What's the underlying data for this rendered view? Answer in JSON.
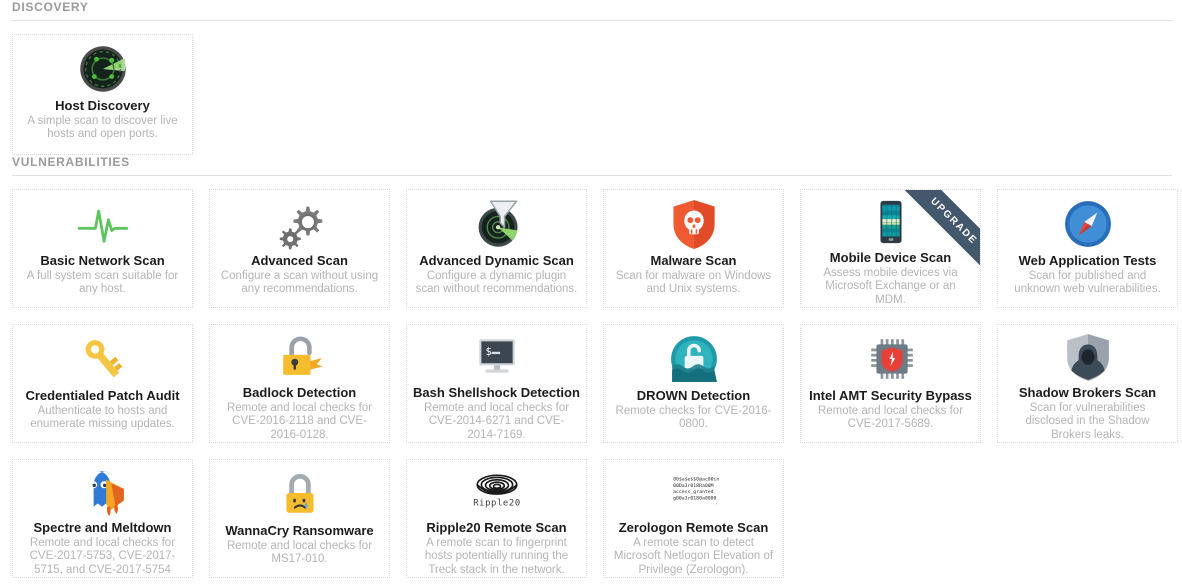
{
  "sections": [
    {
      "id": "discovery",
      "title": "DISCOVERY",
      "cards": [
        {
          "icon": "radar-sweep-icon",
          "title": "Host Discovery",
          "desc": "A simple scan to discover live hosts and open ports.",
          "badge": null
        }
      ]
    },
    {
      "id": "vulnerabilities",
      "title": "VULNERABILITIES",
      "cards": [
        {
          "icon": "heartbeat-pulse-icon",
          "title": "Basic Network Scan",
          "desc": "A full system scan suitable for any host.",
          "badge": null
        },
        {
          "icon": "gears-icon",
          "title": "Advanced Scan",
          "desc": "Configure a scan without using any recommendations.",
          "badge": null
        },
        {
          "icon": "radar-funnel-icon",
          "title": "Advanced Dynamic Scan",
          "desc": "Configure a dynamic plugin scan without recommendations.",
          "badge": null
        },
        {
          "icon": "skull-shield-icon",
          "title": "Malware Scan",
          "desc": "Scan for malware on Windows and Unix systems.",
          "badge": null
        },
        {
          "icon": "mobile-phone-icon",
          "title": "Mobile Device Scan",
          "desc": "Assess mobile devices via Microsoft Exchange or an MDM.",
          "badge": "UPGRADE"
        },
        {
          "icon": "compass-globe-icon",
          "title": "Web Application Tests",
          "desc": "Scan for published and unknown web vulnerabilities.",
          "badge": null
        },
        {
          "icon": "key-icon",
          "title": "Credentialed Patch Audit",
          "desc": "Authenticate to hosts and enumerate missing updates.",
          "badge": null
        },
        {
          "icon": "broken-padlock-icon",
          "title": "Badlock Detection",
          "desc": "Remote and local checks for CVE-2016-2118 and CVE-2016-0128.",
          "badge": null
        },
        {
          "icon": "terminal-monitor-icon",
          "title": "Bash Shellshock Detection",
          "desc": "Remote and local checks for CVE-2014-6271 and CVE-2014-7169.",
          "badge": null
        },
        {
          "icon": "drowning-lock-icon",
          "title": "DROWN Detection",
          "desc": "Remote checks for CVE-2016-0800.",
          "badge": null
        },
        {
          "icon": "cpu-chip-shield-icon",
          "title": "Intel AMT Security Bypass",
          "desc": "Remote and local checks for CVE-2017-5689.",
          "badge": null
        },
        {
          "icon": "hooded-figure-shield-icon",
          "title": "Shadow Brokers Scan",
          "desc": "Scan for vulnerabilities disclosed in the Shadow Brokers leaks.",
          "badge": null
        },
        {
          "icon": "ghost-meltdown-icon",
          "title": "Spectre and Meltdown",
          "desc": "Remote and local checks for CVE-2017-5753, CVE-2017-5715, and CVE-2017-5754",
          "badge": null
        },
        {
          "icon": "crying-padlock-icon",
          "title": "WannaCry Ransomware",
          "desc": "Remote and local checks for MS17-010.",
          "badge": null
        },
        {
          "icon": "ripple20-waves-icon",
          "title": "Ripple20 Remote Scan",
          "desc": "A remote scan to fingerprint hosts potentially running the Treck stack in the network.",
          "badge": null
        },
        {
          "icon": "zerologon-code-icon",
          "title": "Zerologon Remote Scan",
          "desc": "A remote scan to detect Microsoft Netlogon Elevation of Privilege (Zerologon).",
          "badge": null
        }
      ]
    }
  ],
  "colors": {
    "section_header": "#9b9b9b",
    "card_border": "#d9d9d9",
    "card_title": "#1c1c1c",
    "card_desc": "#b4b4b4",
    "ribbon": "#43586c",
    "accent_green": "#5ec45e",
    "accent_orange": "#f05a33",
    "accent_yellow": "#f5bd2e",
    "accent_teal": "#1f9aa8",
    "accent_blue": "#2a6ebb"
  }
}
